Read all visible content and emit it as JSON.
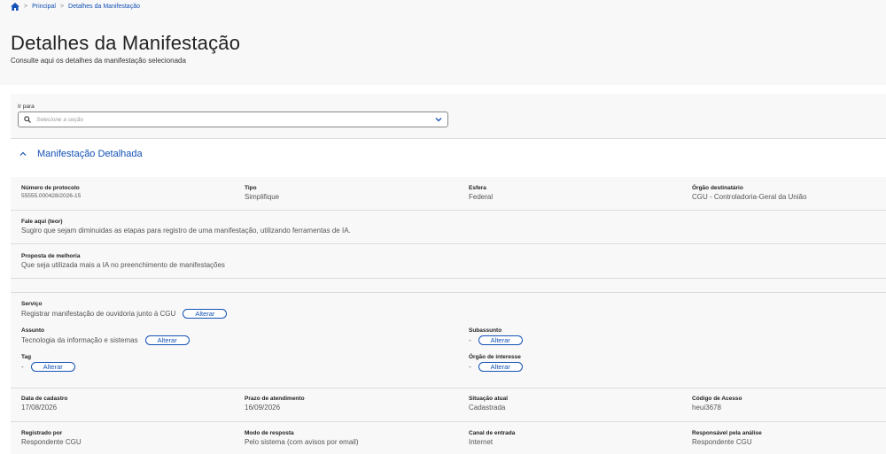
{
  "breadcrumb": {
    "items": [
      "Principal",
      "Detalhes da Manifestação"
    ]
  },
  "header": {
    "title": "Detalhes da Manifestação",
    "subtitle": "Consulte aqui os detalhes da manifestação selecionada"
  },
  "goto": {
    "label": "Ir para",
    "placeholder": "Selecione a seção"
  },
  "section": {
    "title": "Manifestação Detalhada"
  },
  "fields": {
    "protocolo": {
      "label": "Número de protocolo",
      "value": "55555.000428/2026-15"
    },
    "tipo": {
      "label": "Tipo",
      "value": "Simplifique"
    },
    "esfera": {
      "label": "Esfera",
      "value": "Federal"
    },
    "orgao": {
      "label": "Órgão destinatário",
      "value": "CGU - Controladoria-Geral da União"
    },
    "fale": {
      "label": "Fale aqui (teor)",
      "value": "Sugiro que sejam diminuidas as etapas para registro de uma manifestação, utilizando ferramentas de IA."
    },
    "proposta": {
      "label": "Proposta de melhoria",
      "value": "Que seja utilizada mais a IA no preenchimento de manifestações"
    },
    "servico": {
      "label": "Serviço",
      "value": "Registrar manifestação de ouvidoria junto à CGU"
    },
    "assunto": {
      "label": "Assunto",
      "value": "Tecnologia da informação e sistemas"
    },
    "subassunto": {
      "label": "Subassunto",
      "value": "-"
    },
    "tag": {
      "label": "Tag",
      "value": "-"
    },
    "orgao_interesse": {
      "label": "Órgão de interesse",
      "value": "-"
    },
    "data_cadastro": {
      "label": "Data de cadastro",
      "value": "17/08/2026"
    },
    "prazo": {
      "label": "Prazo de atendimento",
      "value": "16/09/2026"
    },
    "situacao": {
      "label": "Situação atual",
      "value": "Cadastrada"
    },
    "codigo": {
      "label": "Código de Acesso",
      "value": "heui3678"
    },
    "registrado": {
      "label": "Registrado por",
      "value": "Respondente CGU"
    },
    "modo": {
      "label": "Modo de resposta",
      "value": "Pelo sistema (com avisos por email)"
    },
    "canal": {
      "label": "Canal de entrada",
      "value": "Internet"
    },
    "responsavel": {
      "label": "Responsável pela análise",
      "value": "Respondente CGU"
    }
  },
  "buttons": {
    "alterar": "Alterar"
  },
  "colors": {
    "accent": "#1351b4",
    "panel": "#f8f8f8"
  }
}
